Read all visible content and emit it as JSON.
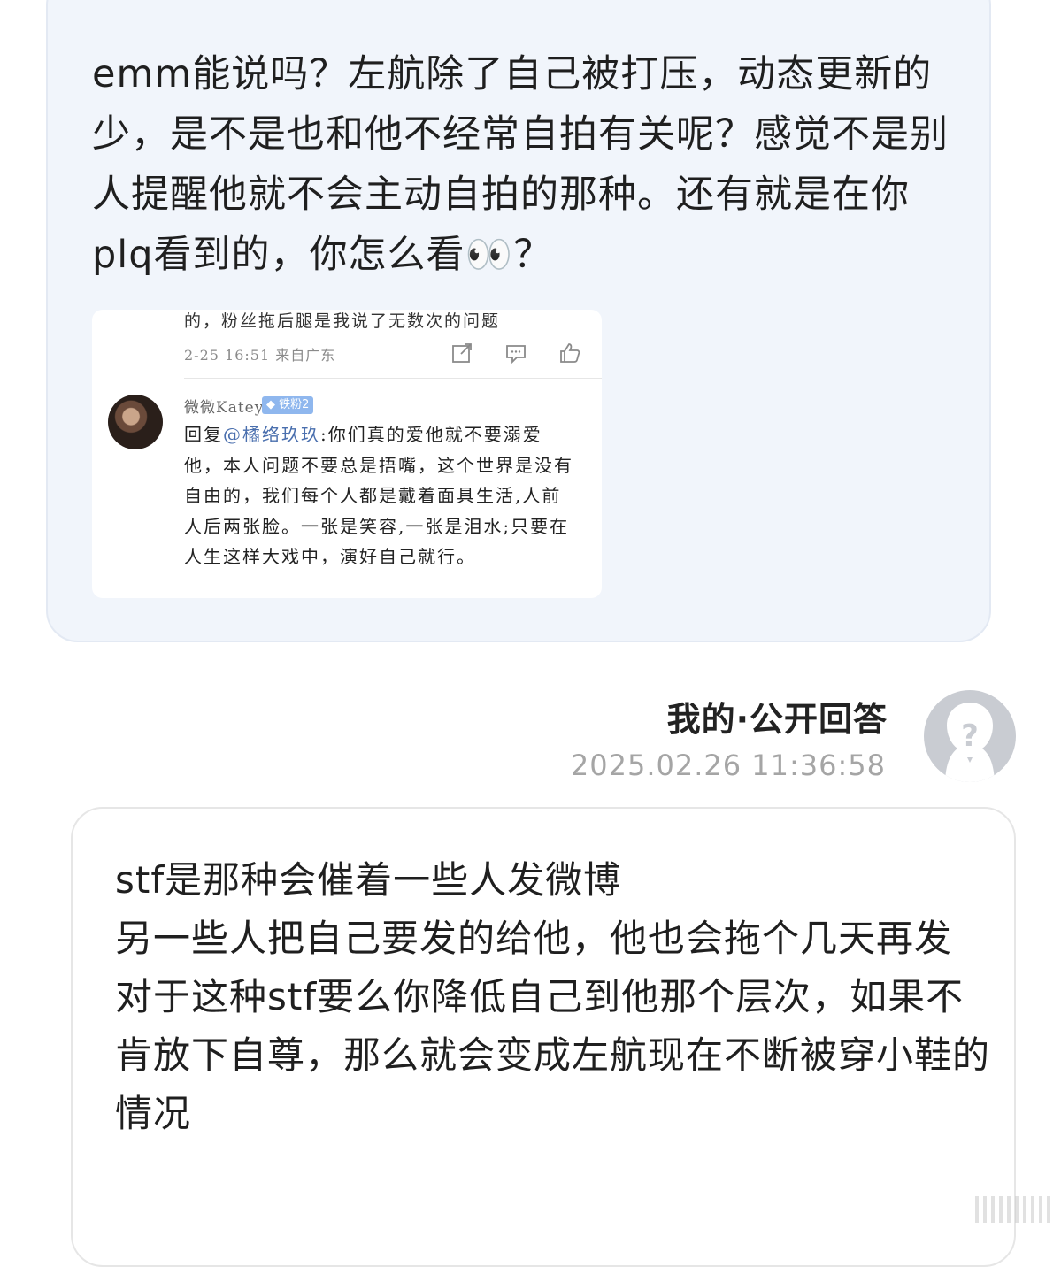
{
  "question": {
    "text": "emm能说吗？左航除了自己被打压，动态更新的少，是不是也和他不经常自拍有关呢？感觉不是别人提醒他就不会主动自拍的那种。还有就是在你plq看到的，你怎么看👀？",
    "screenshot": {
      "top_line": "的，粉丝拖后腿是我说了无数次的问题",
      "meta": "2-25 16:51  来自广东",
      "actions": [
        "share-icon",
        "comment-icon",
        "like-icon"
      ],
      "commenter_name": "微微Katey",
      "badge": "铁粉2",
      "reply_prefix": "回复",
      "mention": "@橘络玖玖",
      "reply_body": ":你们真的爱他就不要溺爱他，本人问题不要总是捂嘴，这个世界是没有自由的，我们每个人都是戴着面具生活,人前人后两张脸。一张是笑容,一张是泪水;只要在人生这样大戏中，演好自己就行。"
    }
  },
  "answer": {
    "author": "我的·公开回答",
    "timestamp": "2025.02.26 11:36:58",
    "avatar": "unknown-user-avatar",
    "text": "stf是那种会催着一些人发微博\n另一些人把自己要发的给他，他也会拖个几天再发\n对于这种stf要么你降低自己到他那个层次，如果不肯放下自尊，那么就会变成左航现在不断被穿小鞋的情况"
  }
}
